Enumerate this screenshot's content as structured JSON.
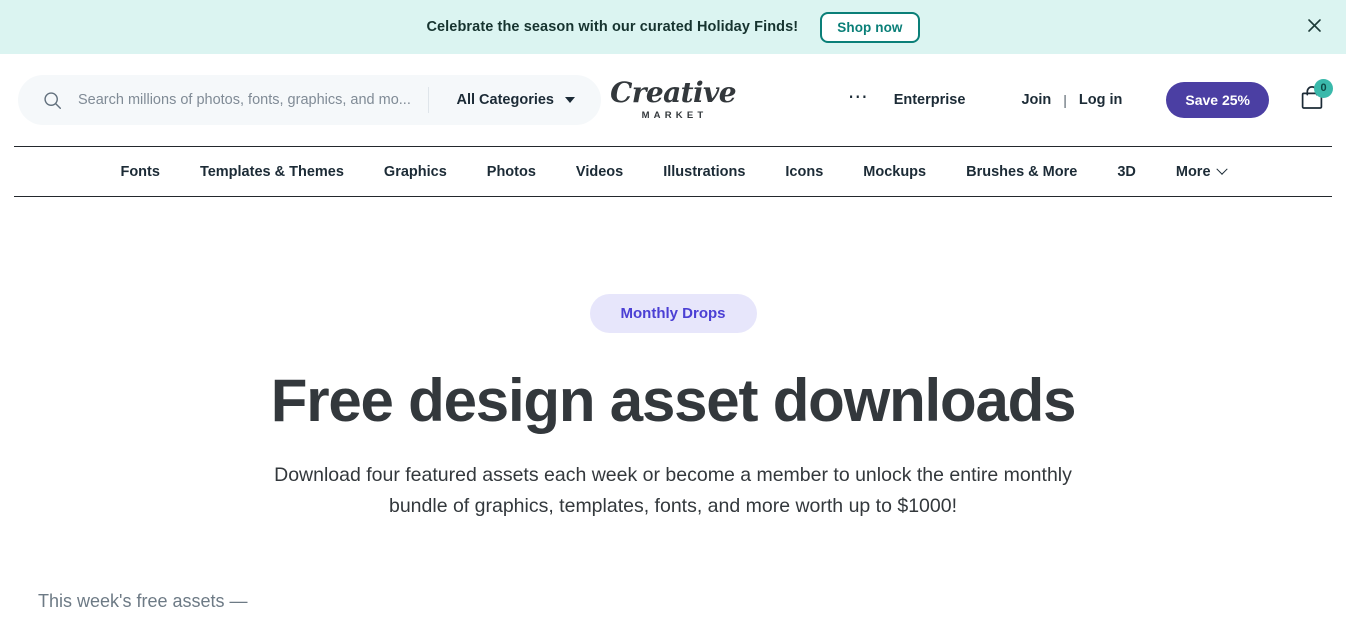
{
  "banner": {
    "message": "Celebrate the season with our curated Holiday Finds!",
    "cta_label": "Shop now",
    "close_icon": "close-icon",
    "bg_color": "#dbf4f1",
    "accent_color": "#0a7f78"
  },
  "header": {
    "search": {
      "placeholder": "Search millions of photos, fonts, graphics, and mo...",
      "value": "",
      "icon": "search-icon"
    },
    "category_select": {
      "selected": "All Categories",
      "caret_icon": "chevron-down-icon"
    },
    "logo": {
      "script": "Creative",
      "sub": "MARKET"
    },
    "overflow_icon": "ellipsis-icon",
    "enterprise_label": "Enterprise",
    "join_label": "Join",
    "separator": "|",
    "login_label": "Log in",
    "save_button_label": "Save 25%",
    "save_button_color": "#4b3fa3",
    "cart": {
      "icon": "shopping-bag-icon",
      "count": "0",
      "badge_color": "#3ab9ab"
    }
  },
  "nav": {
    "items": [
      {
        "label": "Fonts"
      },
      {
        "label": "Templates & Themes"
      },
      {
        "label": "Graphics"
      },
      {
        "label": "Photos"
      },
      {
        "label": "Videos"
      },
      {
        "label": "Illustrations"
      },
      {
        "label": "Icons"
      },
      {
        "label": "Mockups"
      },
      {
        "label": "Brushes & More"
      },
      {
        "label": "3D"
      },
      {
        "label": "More"
      }
    ],
    "more_caret_icon": "chevron-down-icon"
  },
  "hero": {
    "badge": "Monthly Drops",
    "badge_bg": "#e7e6fb",
    "badge_color": "#4b3fd4",
    "title": "Free design asset downloads",
    "subtitle": "Download four featured assets each week or become a member to unlock the entire monthly bundle of graphics, templates, fonts, and more worth up to $1000!"
  },
  "section": {
    "free_assets_label": "This week's free assets —"
  }
}
